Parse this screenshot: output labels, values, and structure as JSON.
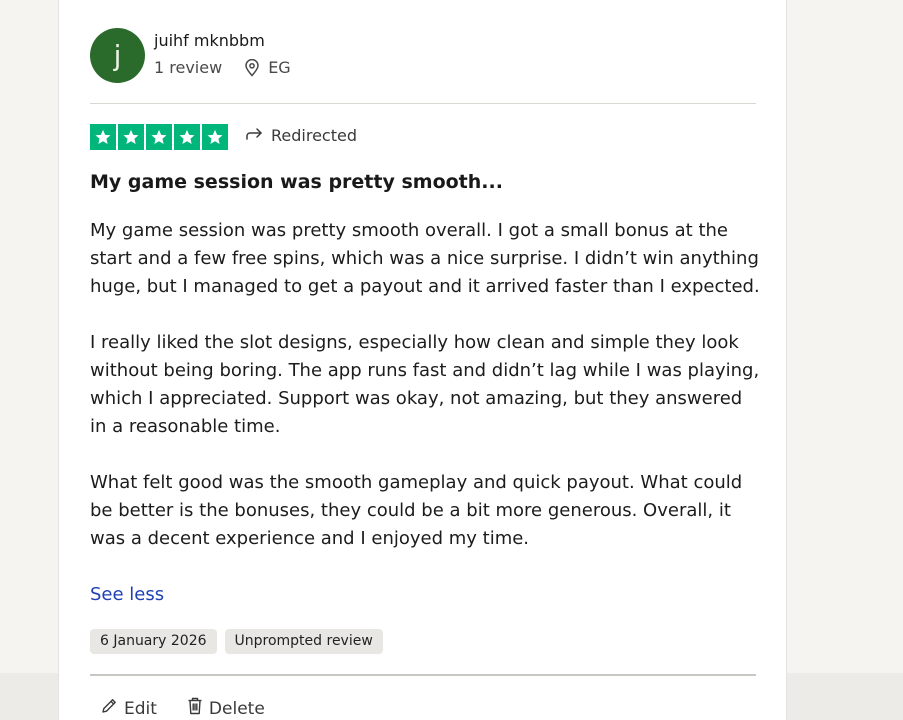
{
  "consumer": {
    "initial": "j",
    "name": "juihf mknbbm",
    "review_count": "1 review",
    "location": "EG",
    "avatar_color": "#2a6b2b"
  },
  "rating": {
    "stars": 5,
    "star_color": "#00b67a",
    "redirected_label": "Redirected"
  },
  "review": {
    "title": "My game session was pretty smooth...",
    "paragraphs": [
      "My game session was pretty smooth overall. I got a small bonus at the start and a few free spins, which was a nice surprise. I didn’t win anything huge, but I managed to get a payout and it arrived faster than I expected.",
      "I really liked the slot designs, especially how clean and simple they look without being boring. The app runs fast and didn’t lag while I was playing, which I appreciated. Support was okay, not amazing, but they answered in a reasonable time.",
      "What felt good was the smooth gameplay and quick payout. What could be better is the bonuses, they could be a bit more generous. Overall, it was a decent experience and I enjoyed my time."
    ],
    "see_less_label": "See less",
    "date": "6 January 2026",
    "review_type": "Unprompted review"
  },
  "actions": {
    "edit_label": "Edit",
    "delete_label": "Delete"
  }
}
